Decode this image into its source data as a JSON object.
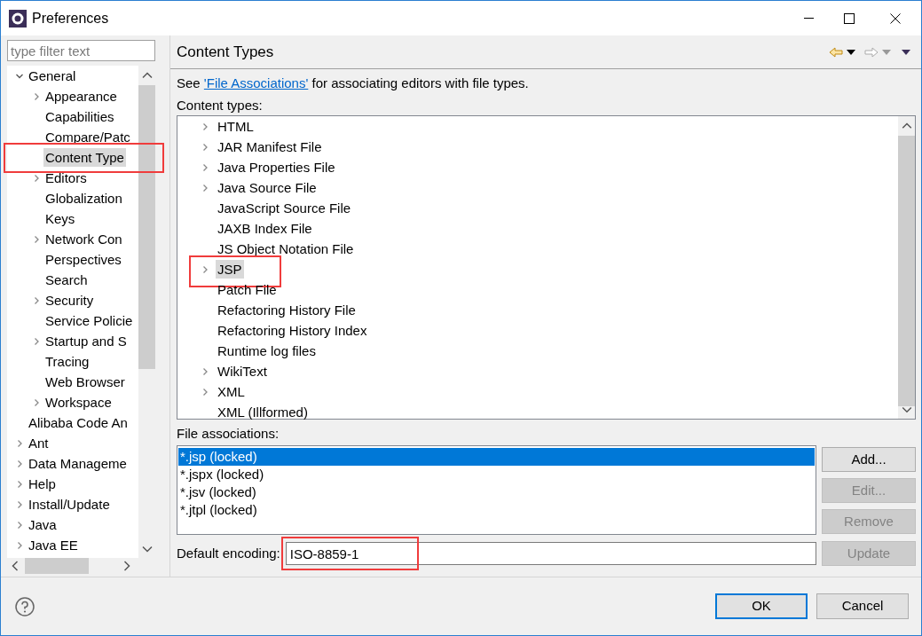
{
  "window": {
    "title": "Preferences"
  },
  "filter": {
    "placeholder": "type filter text"
  },
  "nav_tree": [
    {
      "label": "General",
      "expanded": true,
      "selected": false,
      "highlighted": false,
      "children": [
        {
          "label": "Appearance",
          "expanded": false,
          "selected": false,
          "highlighted": false
        },
        {
          "label": "Capabilities",
          "selected": false,
          "highlighted": false
        },
        {
          "label": "Compare/Patc",
          "selected": false,
          "highlighted": false
        },
        {
          "label": "Content Type",
          "selected": true,
          "highlighted": true
        },
        {
          "label": "Editors",
          "expanded": false,
          "selected": false,
          "highlighted": false
        },
        {
          "label": "Globalization",
          "selected": false,
          "highlighted": false
        },
        {
          "label": "Keys",
          "selected": false,
          "highlighted": false
        },
        {
          "label": "Network Con",
          "expanded": false,
          "selected": false,
          "highlighted": false
        },
        {
          "label": "Perspectives",
          "selected": false,
          "highlighted": false
        },
        {
          "label": "Search",
          "selected": false,
          "highlighted": false
        },
        {
          "label": "Security",
          "expanded": false,
          "selected": false,
          "highlighted": false
        },
        {
          "label": "Service Policie",
          "selected": false,
          "highlighted": false
        },
        {
          "label": "Startup and S",
          "expanded": false,
          "selected": false,
          "highlighted": false
        },
        {
          "label": "Tracing",
          "selected": false,
          "highlighted": false
        },
        {
          "label": "Web Browser",
          "selected": false,
          "highlighted": false
        },
        {
          "label": "Workspace",
          "expanded": false,
          "selected": false,
          "highlighted": false
        }
      ]
    },
    {
      "label": "Alibaba Code An",
      "selected": false,
      "highlighted": false
    },
    {
      "label": "Ant",
      "expanded": false,
      "selected": false,
      "highlighted": false
    },
    {
      "label": "Data Manageme",
      "expanded": false,
      "selected": false,
      "highlighted": false
    },
    {
      "label": "Help",
      "expanded": false,
      "selected": false,
      "highlighted": false
    },
    {
      "label": "Install/Update",
      "expanded": false,
      "selected": false,
      "highlighted": false
    },
    {
      "label": "Java",
      "expanded": false,
      "selected": false,
      "highlighted": false
    },
    {
      "label": "Java EE",
      "expanded": false,
      "selected": false,
      "highlighted": false
    }
  ],
  "page": {
    "title": "Content Types",
    "intro_start": "See ",
    "link": "'File Associations'",
    "intro_end": " for associating editors with file types."
  },
  "content_types": {
    "label": "Content types:",
    "items": [
      {
        "label": "HTML",
        "expanded": false,
        "selected": false,
        "highlighted": false
      },
      {
        "label": "JAR Manifest File",
        "expanded": false,
        "selected": false,
        "highlighted": false
      },
      {
        "label": "Java Properties File",
        "expanded": false,
        "selected": false,
        "highlighted": false
      },
      {
        "label": "Java Source File",
        "expanded": false,
        "selected": false,
        "highlighted": false
      },
      {
        "label": "JavaScript Source File",
        "selected": false,
        "highlighted": false
      },
      {
        "label": "JAXB Index File",
        "selected": false,
        "highlighted": false
      },
      {
        "label": "JS Object Notation File",
        "selected": false,
        "highlighted": false
      },
      {
        "label": "JSP",
        "expanded": false,
        "selected": true,
        "highlighted": true
      },
      {
        "label": "Patch File",
        "selected": false,
        "highlighted": false
      },
      {
        "label": "Refactoring History File",
        "selected": false,
        "highlighted": false
      },
      {
        "label": "Refactoring History Index",
        "selected": false,
        "highlighted": false
      },
      {
        "label": "Runtime log files",
        "selected": false,
        "highlighted": false
      },
      {
        "label": "WikiText",
        "expanded": false,
        "selected": false,
        "highlighted": false
      },
      {
        "label": "XML",
        "expanded": false,
        "selected": false,
        "highlighted": false
      },
      {
        "label": "XML (Illformed)",
        "selected": false,
        "highlighted": false
      }
    ]
  },
  "file_associations": {
    "label": "File associations:",
    "items": [
      {
        "label": "*.jsp (locked)",
        "selected": true
      },
      {
        "label": "*.jspx (locked)",
        "selected": false
      },
      {
        "label": "*.jsv (locked)",
        "selected": false
      },
      {
        "label": "*.jtpl (locked)",
        "selected": false
      }
    ],
    "buttons": [
      {
        "label": "Add...",
        "disabled": false
      },
      {
        "label": "Edit...",
        "disabled": true
      },
      {
        "label": "Remove",
        "disabled": true
      }
    ]
  },
  "encoding": {
    "label": "Default encoding:",
    "value": "ISO-8859-1",
    "highlighted": true,
    "button": {
      "label": "Update",
      "disabled": true
    }
  },
  "dialog_buttons": [
    {
      "label": "OK",
      "default": true
    },
    {
      "label": "Cancel",
      "default": false
    }
  ]
}
